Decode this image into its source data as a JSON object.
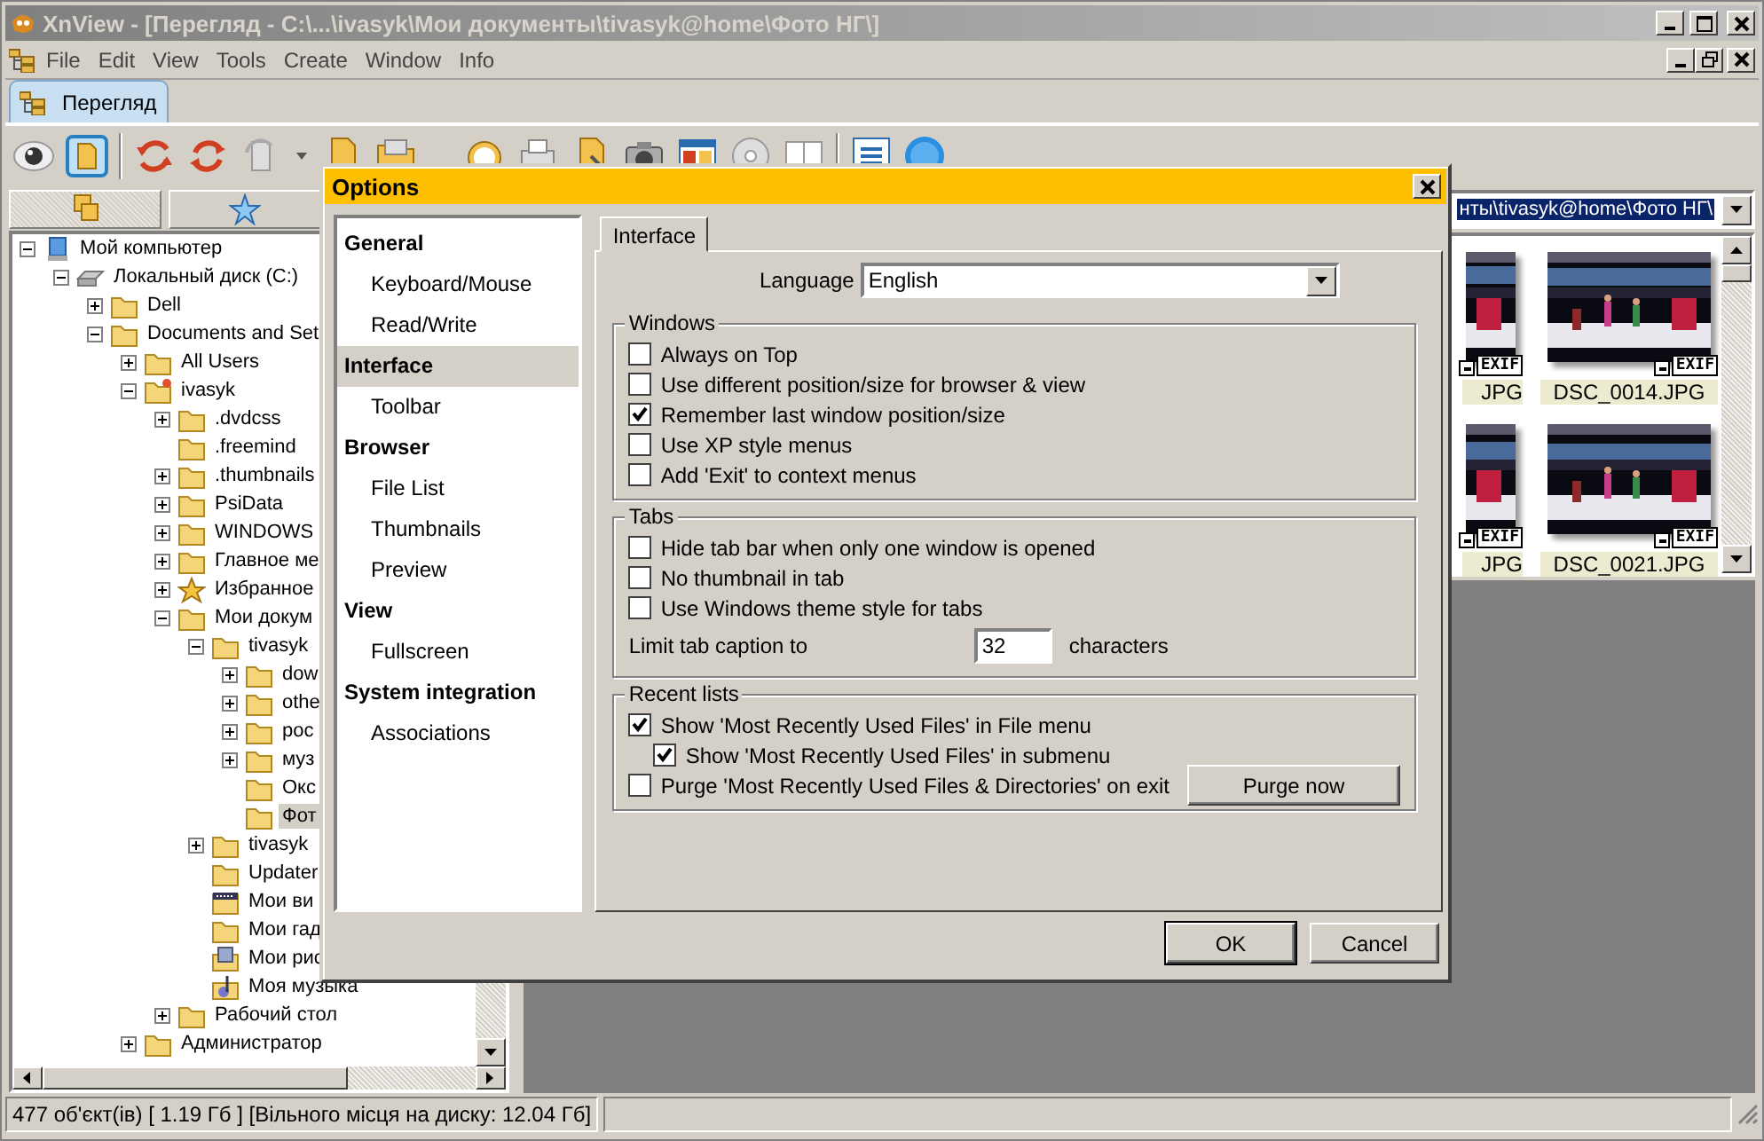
{
  "window": {
    "title": "XnView - [Перегляд - C:\\...\\ivasyk\\Мои документы\\tivasyk@home\\Фото НГ\\]"
  },
  "menu": [
    "File",
    "Edit",
    "View",
    "Tools",
    "Create",
    "Window",
    "Info"
  ],
  "doc_tabs": [
    {
      "label": "Перегляд",
      "selected": true
    }
  ],
  "left_tabs": [
    {
      "selected": true
    },
    {
      "selected": false
    }
  ],
  "tree": [
    {
      "label": "Мой компьютер",
      "kind": "computer",
      "expanded": true,
      "selected": false,
      "children": [
        {
          "label": "Локальный диск (C:)",
          "kind": "drive",
          "expanded": true,
          "selected": false,
          "children": [
            {
              "label": "Dell",
              "kind": "folder",
              "expanded": false,
              "selected": false
            },
            {
              "label": "Documents and Set",
              "kind": "folder",
              "expanded": true,
              "selected": false,
              "children": [
                {
                  "label": "All Users",
                  "kind": "folder",
                  "expanded": false,
                  "selected": false
                },
                {
                  "label": "ivasyk",
                  "kind": "user-folder",
                  "expanded": true,
                  "selected": false,
                  "children": [
                    {
                      "label": ".dvdcss",
                      "kind": "folder",
                      "expanded": false,
                      "selected": false
                    },
                    {
                      "label": ".freemind",
                      "kind": "folder",
                      "selected": false
                    },
                    {
                      "label": ".thumbnails",
                      "kind": "folder",
                      "expanded": false,
                      "selected": false
                    },
                    {
                      "label": "PsiData",
                      "kind": "folder",
                      "expanded": false,
                      "selected": false
                    },
                    {
                      "label": "WINDOWS",
                      "kind": "folder",
                      "expanded": false,
                      "selected": false
                    },
                    {
                      "label": "Главное ме",
                      "kind": "folder",
                      "expanded": false,
                      "selected": false
                    },
                    {
                      "label": "Избранное",
                      "kind": "favorites",
                      "expanded": false,
                      "selected": false
                    },
                    {
                      "label": "Мои докум",
                      "kind": "folder",
                      "expanded": true,
                      "selected": false,
                      "children": [
                        {
                          "label": "tivasyk",
                          "kind": "folder",
                          "expanded": true,
                          "selected": false,
                          "children": [
                            {
                              "label": "dow",
                              "kind": "folder",
                              "expanded": false,
                              "selected": false
                            },
                            {
                              "label": "othe",
                              "kind": "folder",
                              "expanded": false,
                              "selected": false
                            },
                            {
                              "label": "рос",
                              "kind": "folder",
                              "expanded": false,
                              "selected": false
                            },
                            {
                              "label": "муз",
                              "kind": "folder",
                              "expanded": false,
                              "selected": false
                            },
                            {
                              "label": "Окс",
                              "kind": "folder",
                              "selected": false
                            },
                            {
                              "label": "Фот",
                              "kind": "folder",
                              "selected": true
                            }
                          ]
                        },
                        {
                          "label": "tivasyk",
                          "kind": "folder",
                          "expanded": false,
                          "selected": false
                        },
                        {
                          "label": "Updater",
                          "kind": "folder",
                          "selected": false
                        },
                        {
                          "label": "Мои ви",
                          "kind": "video-folder",
                          "selected": false
                        },
                        {
                          "label": "Мои гад",
                          "kind": "folder",
                          "selected": false
                        },
                        {
                          "label": "Мои рис",
                          "kind": "picture-folder",
                          "selected": false
                        },
                        {
                          "label": "Моя музыка",
                          "kind": "music-folder",
                          "selected": false
                        }
                      ]
                    },
                    {
                      "label": "Рабочий стол",
                      "kind": "folder",
                      "expanded": false,
                      "selected": false
                    }
                  ]
                },
                {
                  "label": "Администратор",
                  "kind": "folder",
                  "expanded": false,
                  "selected": false
                }
              ]
            }
          ]
        }
      ]
    }
  ],
  "address": {
    "value": "нты\\tivasyk@home\\Фото НГ\\"
  },
  "thumbnails": [
    {
      "label": "JPG",
      "badge": "EXIF",
      "partial": true
    },
    {
      "label": "DSC_0014.JPG",
      "badge": "EXIF",
      "partial": false
    },
    {
      "label": "JPG",
      "badge": "EXIF",
      "partial": true
    },
    {
      "label": "DSC_0021.JPG",
      "badge": "EXIF",
      "partial": false
    }
  ],
  "status_bar": [
    "477 об'єкт(ів) [ 1.19 Гб ] [Вільного місця на диску: 12.04 Гб]"
  ],
  "dialog": {
    "title": "Options",
    "nav": [
      {
        "label": "General",
        "kind": "section",
        "selected": false
      },
      {
        "label": "Keyboard/Mouse",
        "kind": "page",
        "selected": false
      },
      {
        "label": "Read/Write",
        "kind": "page",
        "selected": false
      },
      {
        "label": "Interface",
        "kind": "section",
        "selected": true
      },
      {
        "label": "Toolbar",
        "kind": "page",
        "selected": false
      },
      {
        "label": "Browser",
        "kind": "section",
        "selected": false
      },
      {
        "label": "File List",
        "kind": "page",
        "selected": false
      },
      {
        "label": "Thumbnails",
        "kind": "page",
        "selected": false
      },
      {
        "label": "Preview",
        "kind": "page",
        "selected": false
      },
      {
        "label": "View",
        "kind": "section",
        "selected": false
      },
      {
        "label": "Fullscreen",
        "kind": "page",
        "selected": false
      },
      {
        "label": "System integration",
        "kind": "section",
        "selected": false
      },
      {
        "label": "Associations",
        "kind": "page",
        "selected": false
      }
    ],
    "tabs": [
      {
        "label": "Interface",
        "selected": true
      }
    ],
    "language": {
      "label": "Language",
      "value": "English"
    },
    "groups": [
      {
        "title": "Windows",
        "items": [
          {
            "kind": "checkbox",
            "label": "Always on Top",
            "checked": false
          },
          {
            "kind": "checkbox",
            "label": "Use different position/size for browser & view",
            "checked": false
          },
          {
            "kind": "checkbox",
            "label": "Remember last window position/size",
            "checked": true
          },
          {
            "kind": "checkbox",
            "label": "Use XP style menus",
            "checked": false
          },
          {
            "kind": "checkbox",
            "label": "Add 'Exit' to context menus",
            "checked": false
          }
        ]
      },
      {
        "title": "Tabs",
        "items": [
          {
            "kind": "checkbox",
            "label": "Hide tab bar when only one window is opened",
            "checked": false
          },
          {
            "kind": "checkbox",
            "label": "No thumbnail in tab",
            "checked": false
          },
          {
            "kind": "checkbox",
            "label": "Use Windows theme style for tabs",
            "checked": false
          },
          {
            "kind": "number",
            "label": "Limit tab caption to",
            "value": "32",
            "unit": "characters"
          }
        ]
      },
      {
        "title": "Recent lists",
        "items": [
          {
            "kind": "checkbox",
            "label": "Show 'Most Recently Used Files' in File menu",
            "checked": true,
            "children": [
              {
                "kind": "checkbox",
                "label": "Show 'Most Recently Used Files' in submenu",
                "checked": true
              }
            ]
          },
          {
            "kind": "checkbox",
            "label": "Purge 'Most Recently Used Files & Directories' on exit",
            "checked": false,
            "button": "Purge now"
          }
        ]
      }
    ],
    "buttons": [
      {
        "label": "OK",
        "default": true
      },
      {
        "label": "Cancel",
        "default": false
      }
    ]
  }
}
